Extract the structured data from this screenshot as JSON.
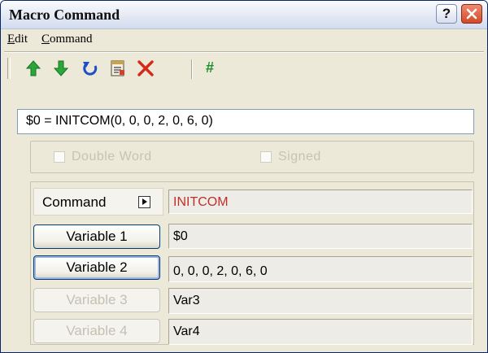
{
  "window": {
    "title": "Macro Command",
    "help_label": "?"
  },
  "menubar": [
    {
      "label": "Edit",
      "mnemonic": "E"
    },
    {
      "label": "Command",
      "mnemonic": "C"
    }
  ],
  "toolbar": {
    "items": [
      {
        "name": "move-up-icon"
      },
      {
        "name": "move-down-icon"
      },
      {
        "name": "undo-icon"
      },
      {
        "name": "properties-icon"
      },
      {
        "name": "delete-icon"
      },
      {
        "name": "hash-icon",
        "label": "#"
      }
    ],
    "colors": {
      "arrows": "#2aa63a",
      "undo": "#1f4fc8",
      "delete": "#d42a1a",
      "hash": "#1f8f2e"
    }
  },
  "expression": {
    "value": "$0 = INITCOM(0, 0, 0, 2, 0, 6, 0)"
  },
  "options": {
    "double_word": {
      "label": "Double Word",
      "checked": false,
      "enabled": false
    },
    "signed": {
      "label": "Signed",
      "checked": false,
      "enabled": false
    }
  },
  "command_row": {
    "button_label": "Command",
    "value": "INITCOM",
    "value_color": "#c0302a"
  },
  "variables": [
    {
      "label": "Variable 1",
      "value": "$0",
      "enabled": true
    },
    {
      "label": "Variable 2",
      "value": "0, 0, 0, 2, 0, 6, 0",
      "enabled": true
    },
    {
      "label": "Variable 3",
      "value": "Var3",
      "enabled": false
    },
    {
      "label": "Variable 4",
      "value": "Var4",
      "enabled": false
    }
  ]
}
